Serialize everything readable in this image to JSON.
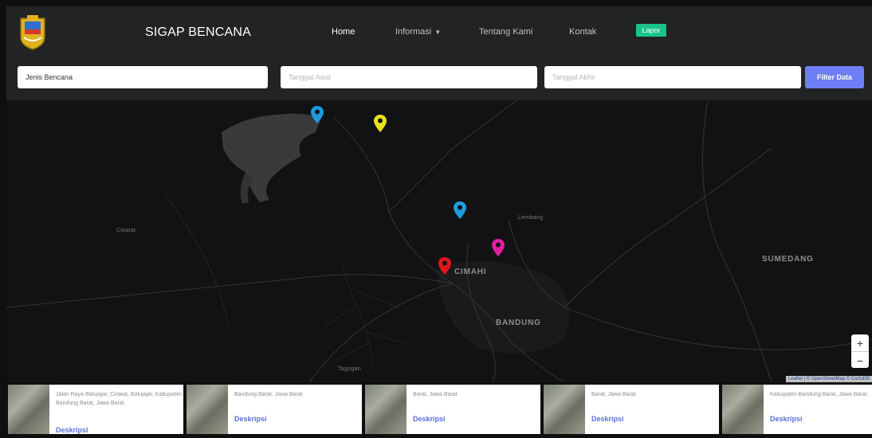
{
  "navbar": {
    "brand": "SIGAP BENCANA",
    "logo_icon": "regional-emblem-logo",
    "links": [
      {
        "label": "Home",
        "active": true
      },
      {
        "label": "Informasi",
        "dropdown": true
      },
      {
        "label": "Tentang Kami"
      },
      {
        "label": "Kontak"
      }
    ],
    "lapor_label": "Lapor",
    "lapor_color": "#19c48a"
  },
  "filter": {
    "jenis_value": "Jenis Bencana",
    "awal_placeholder": "Tanggal Awal",
    "akhir_placeholder": "Tanggal Akhir",
    "button_label": "Filter Data",
    "button_color": "#6e7ff5"
  },
  "map": {
    "places": [
      "Cipatat",
      "Lembang",
      "CIMAHI",
      "BANDUNG",
      "SUMEDANG",
      "Tagogan"
    ],
    "markers": [
      {
        "color": "#1e9bde",
        "icon": "map-marker-icon"
      },
      {
        "color": "#e8e11e",
        "icon": "map-marker-icon"
      },
      {
        "color": "#1e9bde",
        "icon": "map-marker-icon"
      },
      {
        "color": "#e21e9e",
        "icon": "map-marker-icon"
      },
      {
        "color": "#e3151c",
        "icon": "map-marker-icon"
      }
    ],
    "zoom_in": "+",
    "zoom_out": "−",
    "attribution": {
      "leaflet": "Leaflet",
      "osm": "© OpenStreetMap",
      "carto": "© CartoDB"
    }
  },
  "cards": [
    {
      "address": "Jalan Raya Batujajar, Cirawa, Batujajar, Kabupaten Bandung Barat, Jawa Barat",
      "link": "Deskripsi"
    },
    {
      "address": "Bandung Barat, Jawa Barat",
      "link": "Deskripsi"
    },
    {
      "address": "Barat, Jawa Barat",
      "link": "Deskripsi"
    },
    {
      "address": "Barat, Jawa Barat",
      "link": "Deskripsi"
    },
    {
      "address": "Kabupaten Bandung Barat, Jawa Barat",
      "link": "Deskripsi"
    }
  ]
}
